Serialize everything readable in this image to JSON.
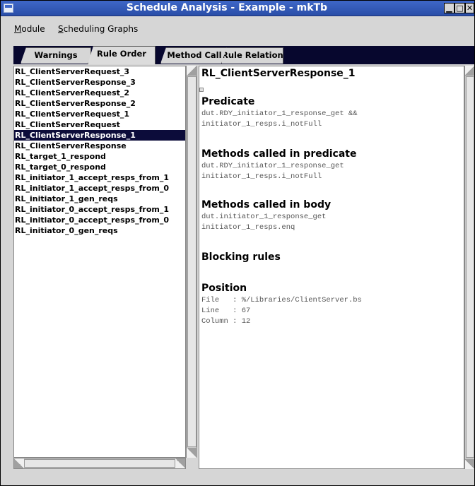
{
  "window": {
    "title": "Schedule Analysis - Example - mkTb",
    "minimize_glyph": "▁",
    "maximize_glyph": "□",
    "close_glyph": "✕"
  },
  "menubar": {
    "module": {
      "underline": "M",
      "rest": "odule"
    },
    "graphs": {
      "underline": "S",
      "rest": "cheduling Graphs"
    }
  },
  "tabs": [
    {
      "label": "Warnings",
      "active": false
    },
    {
      "label": "Rule Order",
      "active": true
    },
    {
      "label": "Method Call",
      "active": false
    },
    {
      "label": "Rule Relations",
      "active": false
    }
  ],
  "rules": [
    "RL_ClientServerRequest_3",
    "RL_ClientServerResponse_3",
    "RL_ClientServerRequest_2",
    "RL_ClientServerResponse_2",
    "RL_ClientServerRequest_1",
    "RL_ClientServerRequest",
    "RL_ClientServerResponse_1",
    "RL_ClientServerResponse",
    "RL_target_1_respond",
    "RL_target_0_respond",
    "RL_initiator_1_accept_resps_from_1",
    "RL_initiator_1_accept_resps_from_0",
    "RL_initiator_1_gen_reqs",
    "RL_initiator_0_accept_resps_from_1",
    "RL_initiator_0_accept_resps_from_0",
    "RL_initiator_0_gen_reqs"
  ],
  "selected_rule": "RL_ClientServerResponse_1",
  "detail": {
    "title": "RL_ClientServerResponse_1",
    "predicate": {
      "heading": "Predicate",
      "text": "dut.RDY_initiator_1_response_get &&\ninitiator_1_resps.i_notFull"
    },
    "methods_in_predicate": {
      "heading": "Methods called in predicate",
      "text": "dut.RDY_initiator_1_response_get\ninitiator_1_resps.i_notFull"
    },
    "methods_in_body": {
      "heading": "Methods called in body",
      "text": "dut.initiator_1_response_get\ninitiator_1_resps.enq"
    },
    "blocking": {
      "heading": "Blocking rules"
    },
    "position": {
      "heading": "Position",
      "text": "File   : %/Libraries/ClientServer.bs\nLine   : 67\nColumn : 12"
    }
  }
}
